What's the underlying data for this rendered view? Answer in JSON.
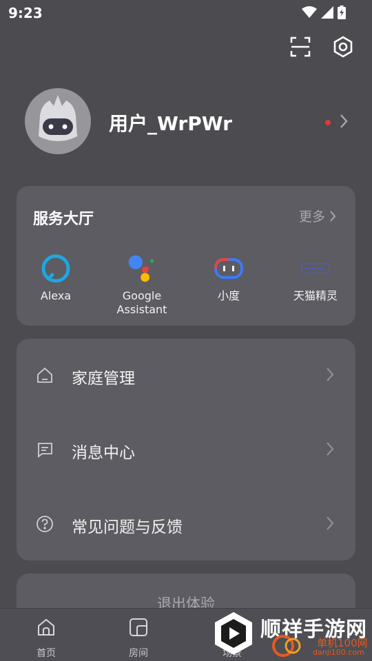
{
  "status_bar": {
    "time": "9:23",
    "icons": [
      "wifi-icon",
      "signal-icon",
      "battery-charging-icon"
    ]
  },
  "top_actions": {
    "icons": [
      "scan-icon",
      "settings-icon"
    ]
  },
  "profile": {
    "username": "用户_WrPWr",
    "avatar_icon": "robot-avatar-icon",
    "has_notification_dot": true
  },
  "service_hall": {
    "title": "服务大厅",
    "more_label": "更多",
    "items": [
      {
        "label": "Alexa",
        "icon": "alexa-icon",
        "color": "#1ea7e1"
      },
      {
        "label": "Google\nAssistant",
        "icon": "google-assistant-icon",
        "color": "#4285f4"
      },
      {
        "label": "小度",
        "icon": "xiaodu-icon",
        "color": "#3d7bf6"
      },
      {
        "label": "天猫精灵",
        "icon": "tmall-genie-icon",
        "color": "#4b5bd8"
      }
    ]
  },
  "menu": {
    "items": [
      {
        "label": "家庭管理",
        "icon": "home-icon"
      },
      {
        "label": "消息中心",
        "icon": "message-icon"
      },
      {
        "label": "常见问题与反馈",
        "icon": "help-icon"
      }
    ]
  },
  "logout": {
    "label": "退出体验"
  },
  "bottom_nav": {
    "items": [
      {
        "label": "首页",
        "icon": "home-tab-icon"
      },
      {
        "label": "房间",
        "icon": "room-tab-icon"
      },
      {
        "label": "场景",
        "icon": "scene-tab-icon"
      }
    ]
  },
  "watermark": {
    "title": "顺祥手游网",
    "sub1": "单机100网",
    "sub2": "danji100.com"
  },
  "colors": {
    "background": "#4b4b50",
    "card": "#5c5c62",
    "notification_dot": "#e03a3a",
    "watermark_accent": "#e65a1f"
  }
}
